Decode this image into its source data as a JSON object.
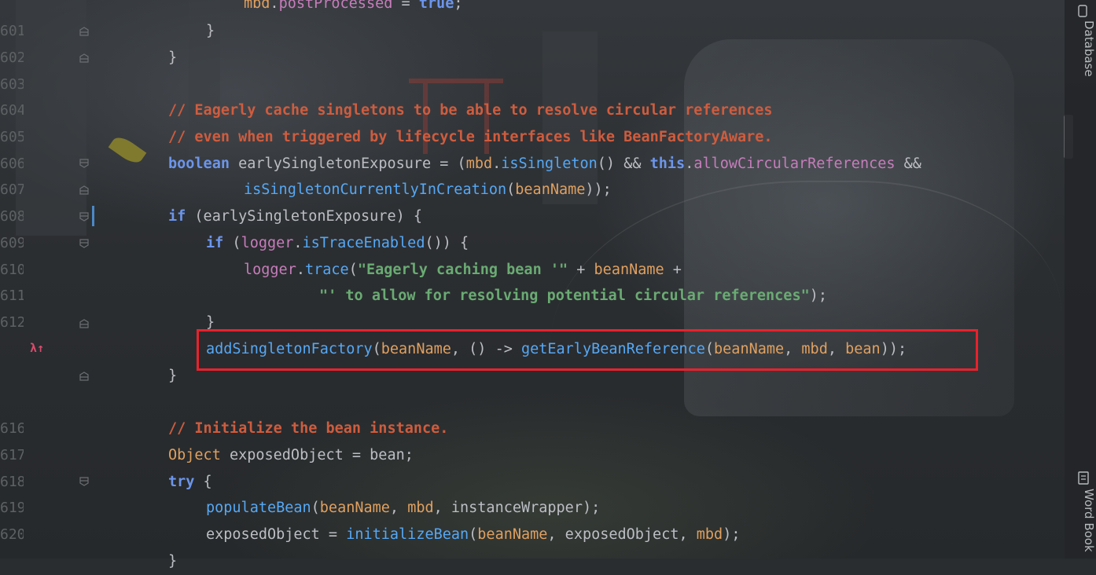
{
  "line_numbers": [
    "601",
    "602",
    "603",
    "604",
    "605",
    "606",
    "607",
    "608",
    "609",
    "610",
    "611",
    "612",
    "",
    "",
    "616",
    "617",
    "618",
    "619",
    "620"
  ],
  "code": {
    "line_top_partial": [
      "mbd",
      ".",
      "postProcessed",
      " = ",
      "true",
      ";"
    ],
    "l601": "}",
    "l602": "}",
    "l604": "// Eagerly cache singletons to be able to resolve circular references",
    "l605": "// even when triggered by lifecycle interfaces like BeanFactoryAware.",
    "l606": {
      "kw1": "boolean",
      "t1": " earlySingletonExposure = (",
      "v1": "mbd",
      ".": ".",
      "f1": "isSingleton",
      "t2": "() && ",
      "kw2": "this",
      "t3": ".",
      "fld": "allowCircularReferences",
      "t4": " &&"
    },
    "l607": {
      "f1": "isSingletonCurrentlyInCreation",
      "t1": "(",
      "v1": "beanName",
      "t2": "));"
    },
    "l608": {
      "kw": "if",
      "t1": " (earlySingletonExposure) {"
    },
    "l609": {
      "kw": "if",
      "t1": " (",
      "fld": "logger",
      "t2": ".",
      "f1": "isTraceEnabled",
      "t3": "()) {"
    },
    "l610": {
      "fld": "logger",
      "t1": ".",
      "f1": "trace",
      "t2": "(",
      "s1": "\"Eagerly caching bean '\"",
      "t3": " + ",
      "v1": "beanName",
      "t4": " +"
    },
    "l611": {
      "s1": "\"' to allow for resolving potential circular references\"",
      "t1": ");"
    },
    "l612": "}",
    "l613": {
      "f1": "addSingletonFactory",
      "t1": "(",
      "v1": "beanName",
      "t2": ", () -> ",
      "f2": "getEarlyBeanReference",
      "t3": "(",
      "v2": "beanName",
      "t4": ", ",
      "v3": "mbd",
      "t5": ", ",
      "v4": "bean",
      "t6": "));"
    },
    "l614": "}",
    "l616": "// Initialize the bean instance.",
    "l617": {
      "ty": "Object",
      "t1": " exposedObject = bean;"
    },
    "l618": {
      "kw": "try",
      "t1": " {"
    },
    "l619": {
      "f1": "populateBean",
      "t1": "(",
      "v1": "beanName",
      "t2": ", ",
      "v2": "mbd",
      "t3": ", instanceWrapper);"
    },
    "l620": {
      "t0": "exposedObject = ",
      "f1": "initializeBean",
      "t1": "(",
      "v1": "beanName",
      "t2": ", exposedObject, ",
      "v2": "mbd",
      "t3": ");"
    },
    "l621": "}"
  },
  "side_tabs": {
    "database": "Database",
    "word_book": "Word Book"
  },
  "gutter_icon": "λ↑",
  "colors": {
    "keyword": "#6c95eb",
    "comment": "#cf5c3e",
    "method": "#56a8f5",
    "field": "#c77dbb",
    "param": "#e0a060",
    "string": "#6aab73",
    "highlight_border": "#e8222c"
  },
  "icons": [
    "fold-marker-icon",
    "lambda-override-icon",
    "database-tab-icon",
    "word-book-tab-icon"
  ]
}
